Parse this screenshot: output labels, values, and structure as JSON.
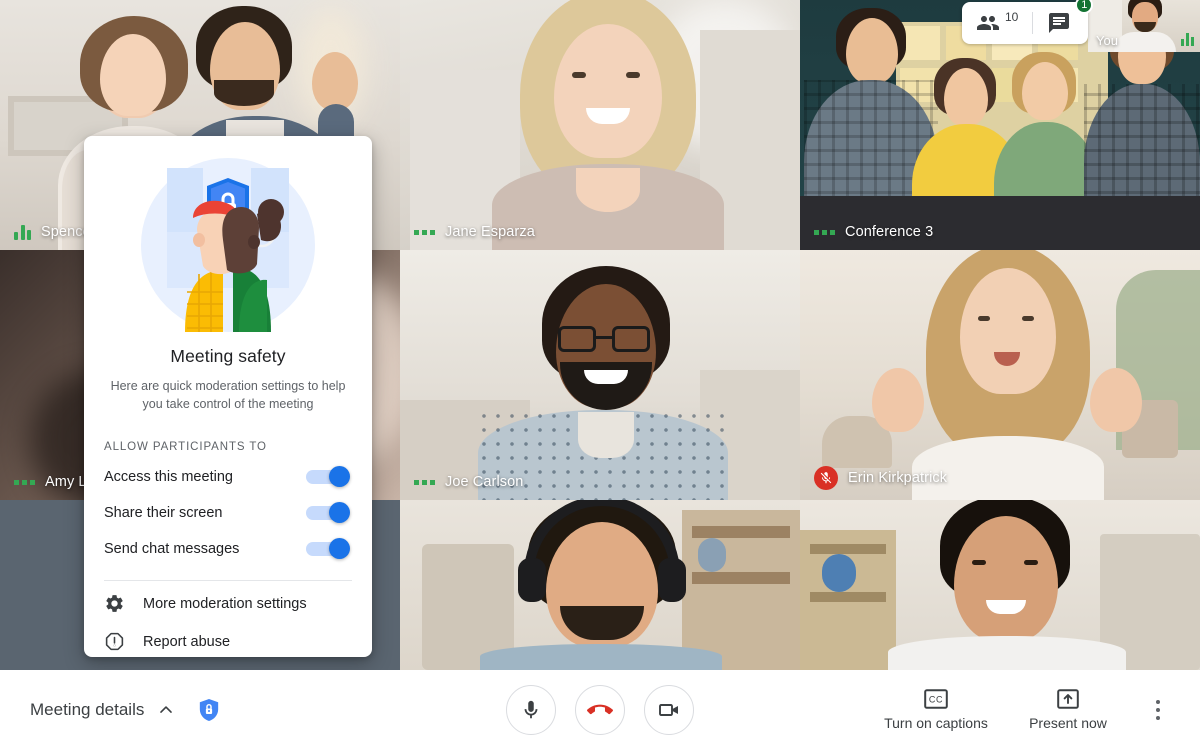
{
  "header": {
    "participants_icon": "people-icon",
    "participants_count": "10",
    "chat_icon": "chat-icon",
    "chat_badge": "1",
    "selfview_label": "You"
  },
  "grid": {
    "tiles": [
      {
        "id": "spencer",
        "name": "Spencer",
        "audio": "active",
        "muted": false
      },
      {
        "id": "jane",
        "name": "Jane Esparza",
        "audio": "idle",
        "muted": false
      },
      {
        "id": "conference",
        "name": "Conference 3",
        "audio": "idle",
        "muted": false
      },
      {
        "id": "amy",
        "name": "Amy Lua",
        "audio": "idle",
        "muted": false
      },
      {
        "id": "joe",
        "name": "Joe Carlson",
        "audio": "idle",
        "muted": false
      },
      {
        "id": "erin",
        "name": "Erin Kirkpatrick",
        "audio": "muted",
        "muted": true
      },
      {
        "id": "blank",
        "name": "",
        "audio": "none",
        "muted": false
      },
      {
        "id": "headphones",
        "name": "",
        "audio": "none",
        "muted": false
      },
      {
        "id": "dev",
        "name": "",
        "audio": "none",
        "muted": false
      }
    ]
  },
  "dialog": {
    "illustration": "meeting-safety-illustration",
    "title": "Meeting safety",
    "subtitle": "Here are quick moderation settings to help you take control of the meeting",
    "section_heading": "ALLOW PARTICIPANTS TO",
    "toggles": [
      {
        "label": "Access this meeting",
        "on": true
      },
      {
        "label": "Share their screen",
        "on": true
      },
      {
        "label": "Send chat messages",
        "on": true
      }
    ],
    "menu_items": [
      {
        "label": "More moderation settings",
        "icon": "gear-icon"
      },
      {
        "label": "Report abuse",
        "icon": "exclamation-octagon-icon"
      }
    ]
  },
  "toolbar": {
    "meeting_details_label": "Meeting details",
    "meeting_details_chevron": "chevron-up-icon",
    "host_controls_icon": "shield-lock-icon",
    "mic_button": "microphone-icon",
    "hangup_button": "end-call-icon",
    "camera_button": "video-camera-icon",
    "captions_label": "Turn on captions",
    "captions_icon": "closed-captions-icon",
    "present_label": "Present now",
    "present_icon": "present-screen-icon",
    "more_options_icon": "more-vertical-icon"
  },
  "colors": {
    "accent_blue": "#1a73e8",
    "toggle_track": "#c6dafc",
    "green": "#34a853",
    "badge_green": "#137333",
    "red": "#d93025",
    "text_primary": "#202124",
    "text_secondary": "#5f6368"
  }
}
